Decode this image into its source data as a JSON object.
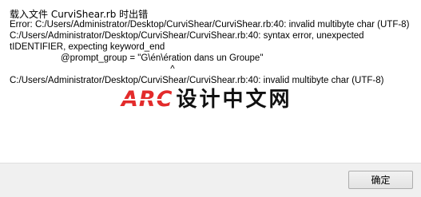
{
  "dialog": {
    "title": "载入文件 CurviShear.rb 时出错",
    "message": "Error: C:/Users/Administrator/Desktop/CurviShear/CurviShear.rb:40: invalid multibyte char (UTF-8)\nC:/Users/Administrator/Desktop/CurviShear/CurviShear.rb:40: syntax error, unexpected\ntIDENTIFIER, expecting keyword_end\n                    @prompt_group = \"G\\én\\ération dans un Groupe\"\n                                                               ^\nC:/Users/Administrator/Desktop/CurviShear/CurviShear.rb:40: invalid multibyte char (UTF-8)",
    "ok_label": "确定"
  },
  "watermark": {
    "logo": "ARC",
    "text": "设计中文网"
  },
  "colors": {
    "watermark_logo": "#e32b2b",
    "content_bg": "#ffffff",
    "dialog_bg": "#f0f0f0"
  }
}
